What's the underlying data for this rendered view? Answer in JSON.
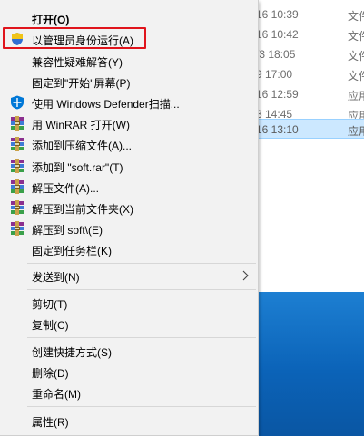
{
  "explorer": {
    "rows": [
      {
        "date": "16 10:39",
        "type": "文件"
      },
      {
        "date": "16 10:42",
        "type": "文件"
      },
      {
        "date": "/3 18:05",
        "type": "文件"
      },
      {
        "date": "9 17:00",
        "type": "文件"
      },
      {
        "date": "16 12:59",
        "type": "应用"
      },
      {
        "date": "3 14:45",
        "type": "应用"
      },
      {
        "date": "16 13:10",
        "type": "应用"
      }
    ],
    "selected_row": 6
  },
  "menu": {
    "open": "打开(O)",
    "run_as_admin": "以管理员身份运行(A)",
    "compat": "兼容性疑难解答(Y)",
    "pin_start": "固定到\"开始\"屏幕(P)",
    "defender": "使用 Windows Defender扫描...",
    "winrar_open": "用 WinRAR 打开(W)",
    "add_archive": "添加到压缩文件(A)...",
    "add_soft_rar": "添加到 \"soft.rar\"(T)",
    "extract_files": "解压文件(A)...",
    "extract_here": "解压到当前文件夹(X)",
    "extract_to_soft": "解压到 soft\\(E)",
    "pin_taskbar": "固定到任务栏(K)",
    "send_to": "发送到(N)",
    "cut": "剪切(T)",
    "copy": "复制(C)",
    "create_shortcut": "创建快捷方式(S)",
    "delete": "删除(D)",
    "rename": "重命名(M)",
    "properties": "属性(R)"
  },
  "colors": {
    "highlight_border": "#e0141c",
    "selected_row": "#cce8ff",
    "defender_blue": "#0078d7"
  }
}
